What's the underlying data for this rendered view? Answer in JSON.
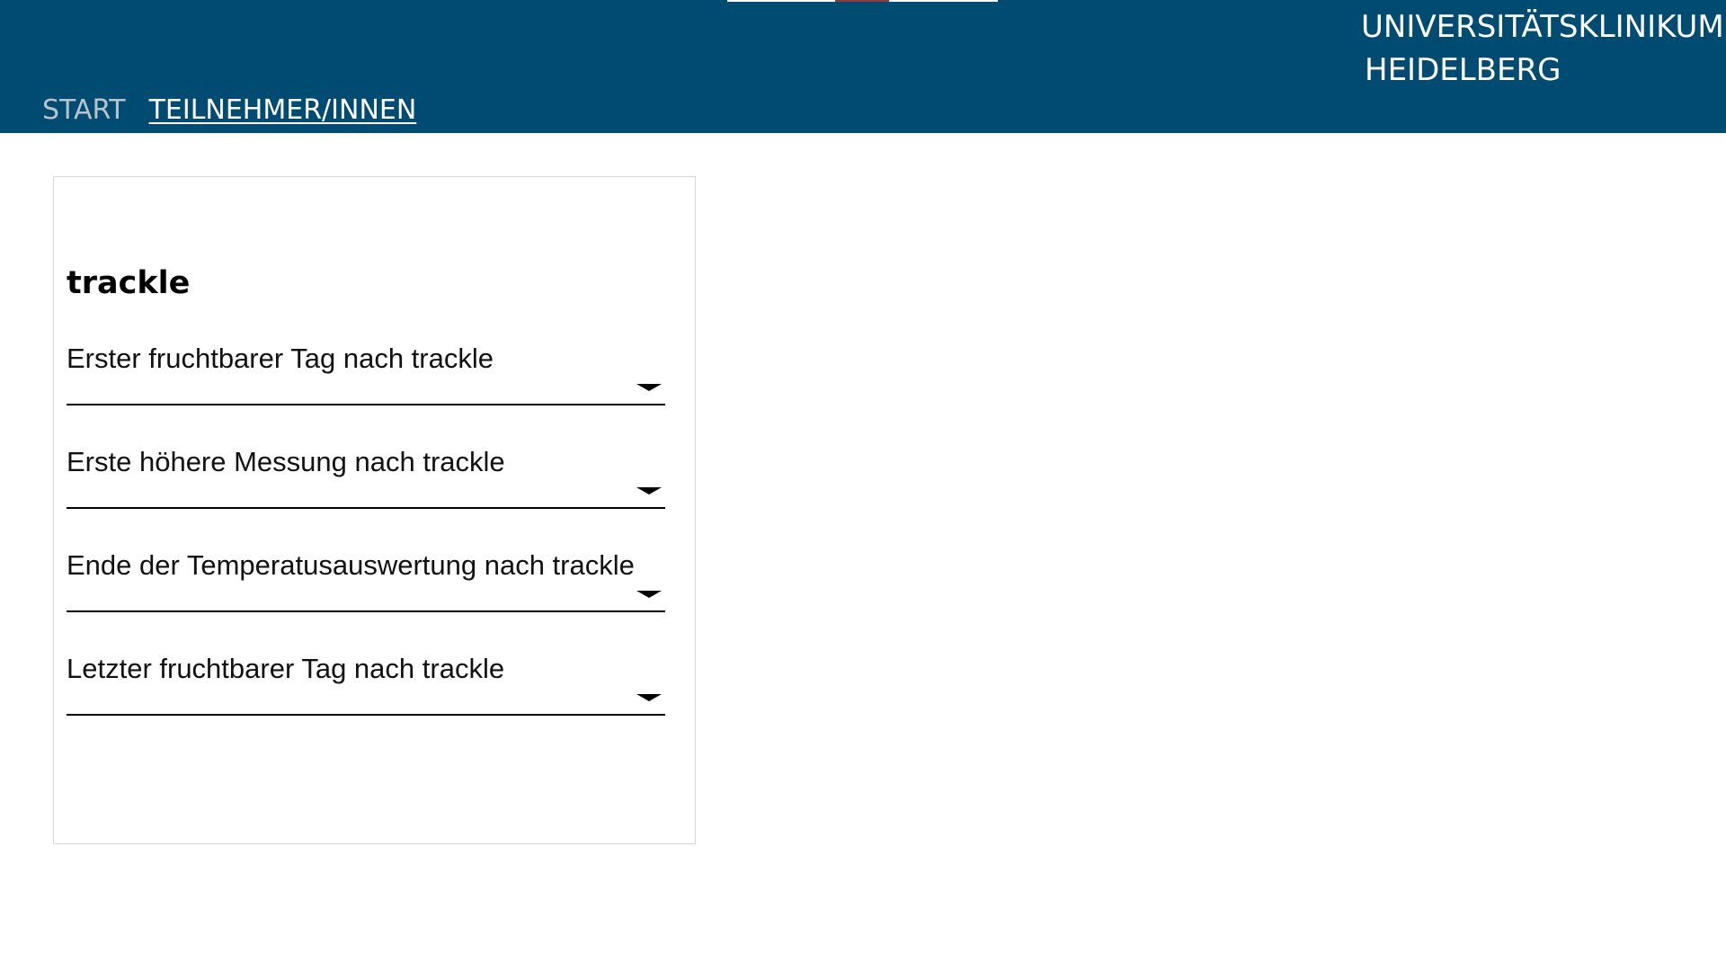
{
  "header": {
    "logo_line1": "UNIVERSITÄTSKLINIKUM",
    "logo_line2": "HEIDELBERG",
    "background_color": "#004b72"
  },
  "nav": {
    "items": [
      {
        "label": "START",
        "active": false
      },
      {
        "label": "TEILNEHMER/INNEN",
        "active": true
      }
    ]
  },
  "card": {
    "title": "trackle",
    "selects": [
      {
        "label": "Erster fruchtbarer Tag nach trackle",
        "icon": "chevron-down-icon"
      },
      {
        "label": "Erste höhere Messung nach trackle",
        "icon": "chevron-down-icon"
      },
      {
        "label": "Ende der Temperatusauswertung nach trackle",
        "icon": "chevron-down-icon"
      },
      {
        "label": "Letzter fruchtbarer Tag nach trackle",
        "icon": "chevron-down-icon"
      }
    ]
  }
}
